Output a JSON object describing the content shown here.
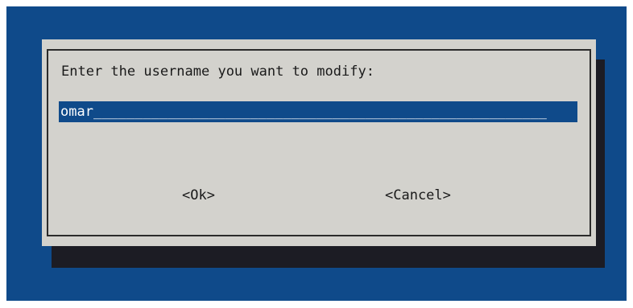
{
  "dialog": {
    "prompt": "Enter the username you want to modify:",
    "input_value": "omar",
    "input_fill": "_______________________________________________________",
    "ok_label": "<Ok>",
    "cancel_label": "<Cancel>"
  },
  "colors": {
    "background": "#0f4a8a",
    "dialog": "#d3d2cd",
    "shadow": "#1c1c24",
    "input_bg": "#0f4a8a",
    "input_text": "#ffffff"
  }
}
